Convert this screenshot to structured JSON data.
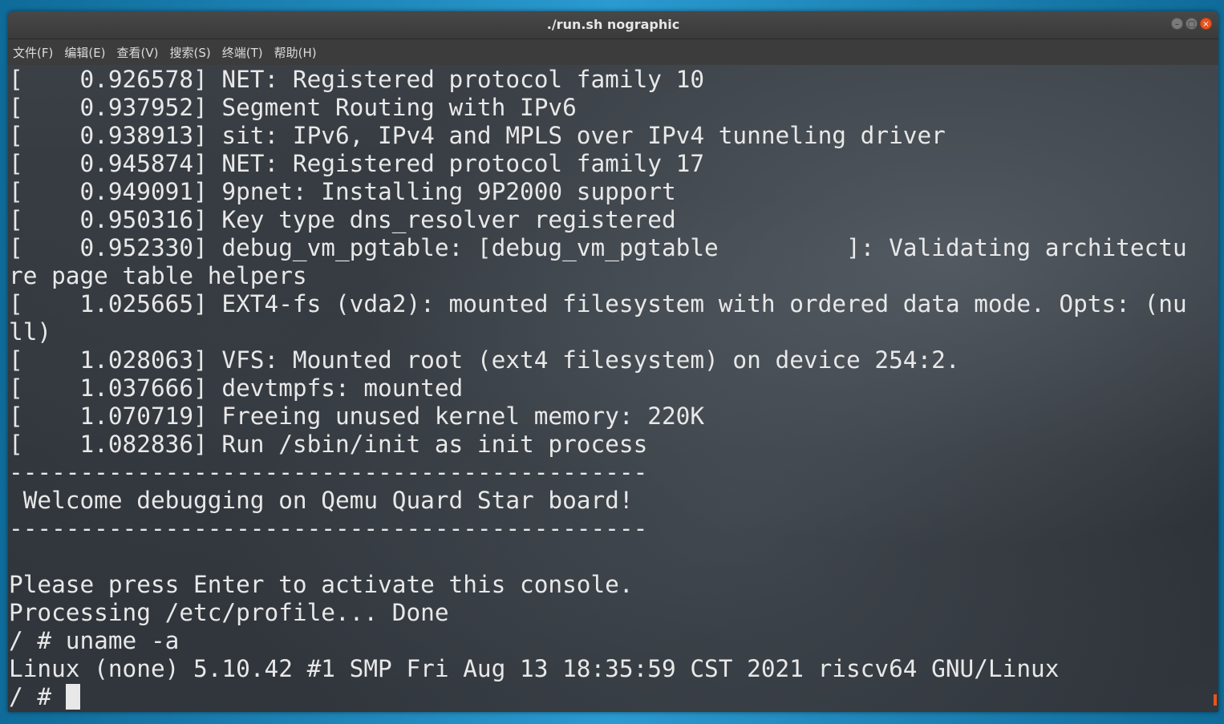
{
  "window": {
    "title": "./run.sh nographic",
    "controls": {
      "minimize": "–",
      "maximize": "□",
      "close": "×"
    }
  },
  "menubar": {
    "items": [
      "文件(F)",
      "编辑(E)",
      "查看(V)",
      "搜索(S)",
      "终端(T)",
      "帮助(H)"
    ]
  },
  "terminal": {
    "lines": [
      "[    0.926578] NET: Registered protocol family 10",
      "[    0.937952] Segment Routing with IPv6",
      "[    0.938913] sit: IPv6, IPv4 and MPLS over IPv4 tunneling driver",
      "[    0.945874] NET: Registered protocol family 17",
      "[    0.949091] 9pnet: Installing 9P2000 support",
      "[    0.950316] Key type dns_resolver registered",
      "[    0.952330] debug_vm_pgtable: [debug_vm_pgtable         ]: Validating architectu",
      "re page table helpers",
      "[    1.025665] EXT4-fs (vda2): mounted filesystem with ordered data mode. Opts: (nu",
      "ll)",
      "[    1.028063] VFS: Mounted root (ext4 filesystem) on device 254:2.",
      "[    1.037666] devtmpfs: mounted",
      "[    1.070719] Freeing unused kernel memory: 220K",
      "[    1.082836] Run /sbin/init as init process",
      "---------------------------------------------",
      " Welcome debugging on Qemu Quard Star board!",
      "---------------------------------------------",
      "",
      "Please press Enter to activate this console.",
      "Processing /etc/profile... Done",
      "/ # uname -a",
      "Linux (none) 5.10.42 #1 SMP Fri Aug 13 18:35:59 CST 2021 riscv64 GNU/Linux"
    ],
    "prompt": "/ # "
  }
}
